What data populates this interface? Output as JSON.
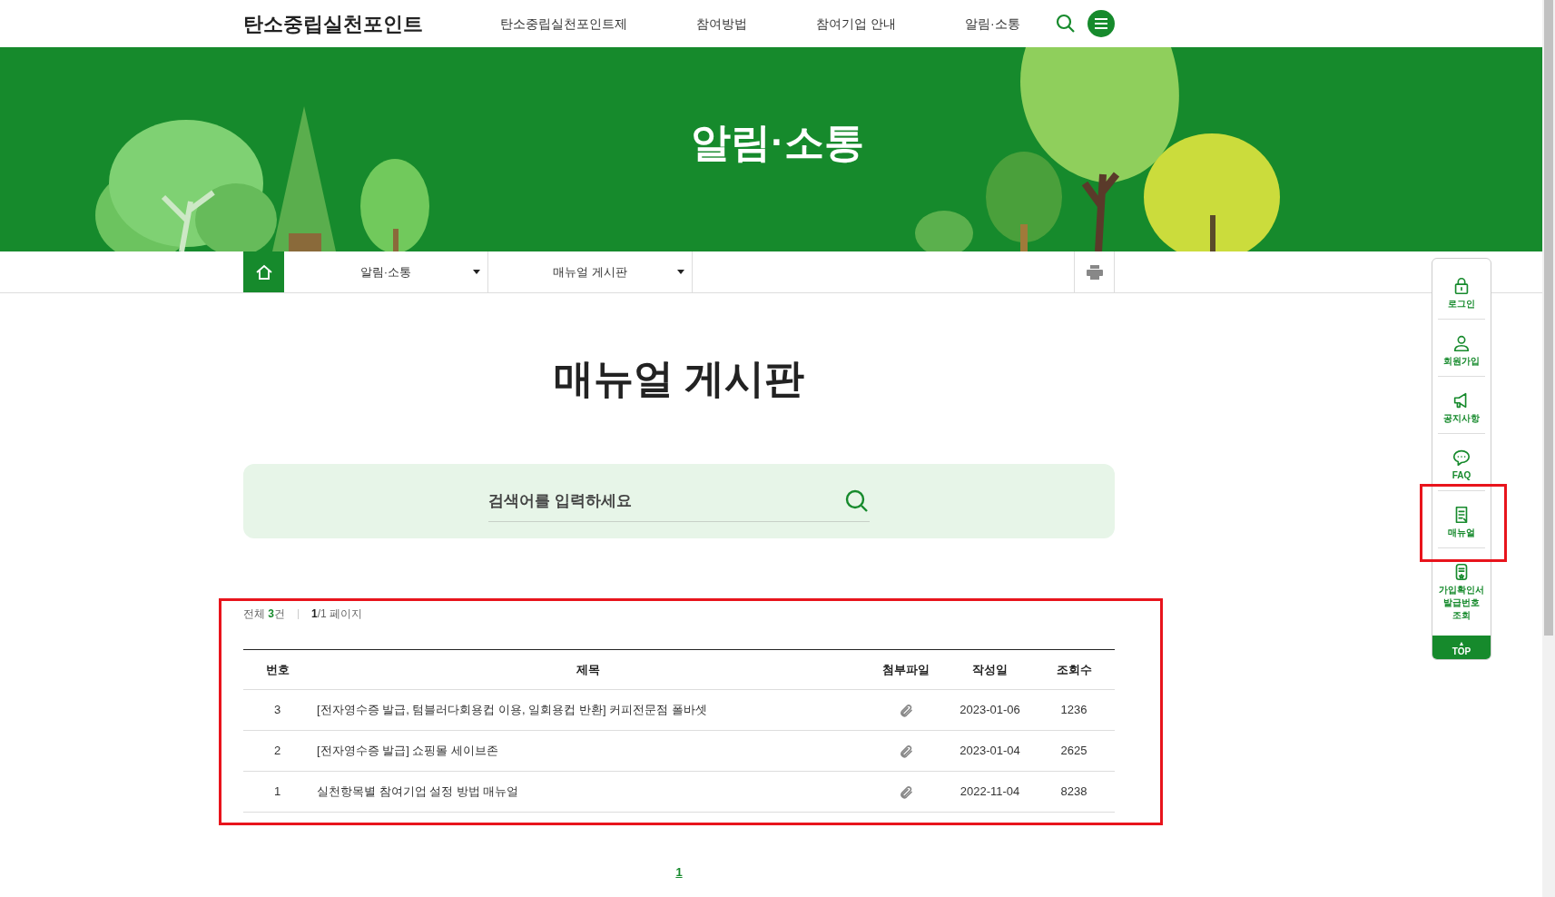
{
  "header": {
    "logo": "탄소중립실천포인트",
    "nav": [
      {
        "label": "탄소중립실천포인트제"
      },
      {
        "label": "참여방법"
      },
      {
        "label": "참여기업 안내"
      },
      {
        "label": "알림·소통"
      }
    ]
  },
  "banner": {
    "title": "알림·소통"
  },
  "breadcrumb": {
    "items": [
      {
        "label": "알림·소통"
      },
      {
        "label": "매뉴얼 게시판"
      }
    ]
  },
  "page_title": "매뉴얼 게시판",
  "search": {
    "placeholder": "검색어를 입력하세요"
  },
  "board": {
    "highlighted": true,
    "summary": {
      "total_label": "전체",
      "total_count": "3",
      "total_unit": "건",
      "page_current": "1",
      "page_rest": "/1 페이지"
    },
    "columns": [
      "번호",
      "제목",
      "첨부파일",
      "작성일",
      "조회수"
    ],
    "rows": [
      {
        "number": "3",
        "title": "[전자영수증 발급, 텀블러다회용컵 이용, 일회용컵 반환] 커피전문점 폴바셋",
        "attachment": true,
        "date": "2023-01-06",
        "views": "1236"
      },
      {
        "number": "2",
        "title": "[전자영수증 발급] 쇼핑몰 세이브존",
        "attachment": true,
        "date": "2023-01-04",
        "views": "2625"
      },
      {
        "number": "1",
        "title": "실천항목별 참여기업 설정 방법 매뉴얼",
        "attachment": true,
        "date": "2022-11-04",
        "views": "8238"
      }
    ]
  },
  "pagination": [
    {
      "label": "1",
      "selected": true
    }
  ],
  "quick_menu": {
    "items": [
      {
        "kind": "lock",
        "label": "로그인",
        "highlighted": false
      },
      {
        "kind": "person",
        "label": "회원가입",
        "highlighted": false
      },
      {
        "kind": "megaphone",
        "label": "공지사항",
        "highlighted": false
      },
      {
        "kind": "chat",
        "label": "FAQ",
        "highlighted": false
      },
      {
        "kind": "document",
        "label": "매뉴얼",
        "highlighted": true
      },
      {
        "kind": "certificate",
        "label": "가입확인서 발급번호 조회",
        "highlighted": false
      }
    ],
    "top": {
      "arrow": "▲",
      "label": "TOP"
    }
  }
}
